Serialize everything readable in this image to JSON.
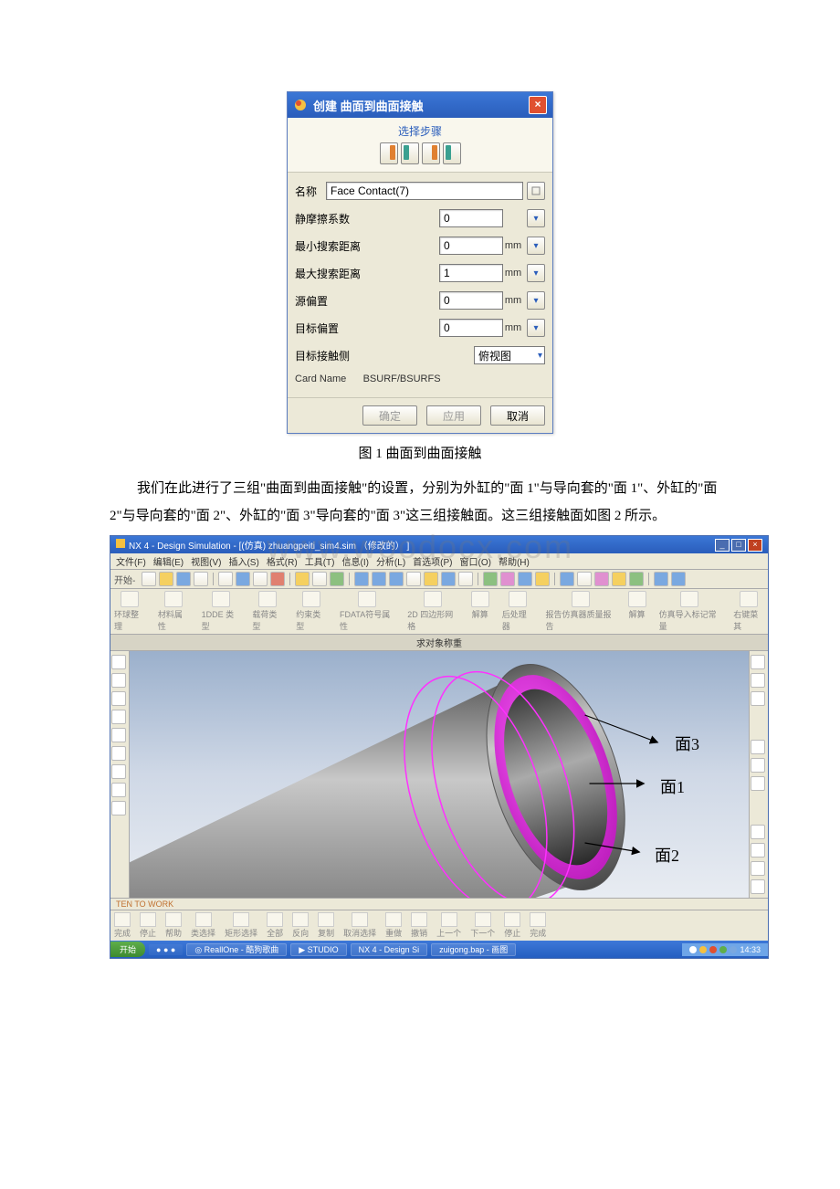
{
  "dialog": {
    "title": "创建  曲面到曲面接触",
    "steps_label": "选择步骤",
    "name_label": "名称",
    "name_value": "Face Contact(7)",
    "fields": [
      {
        "label": "静摩擦系数",
        "value": "0",
        "unit": ""
      },
      {
        "label": "最小搜索距离",
        "value": "0",
        "unit": "mm"
      },
      {
        "label": "最大搜索距离",
        "value": "1",
        "unit": "mm"
      },
      {
        "label": "源偏置",
        "value": "0",
        "unit": "mm"
      },
      {
        "label": "目标偏置",
        "value": "0",
        "unit": "mm"
      }
    ],
    "target_side_label": "目标接触侧",
    "target_side_value": "俯视图",
    "card_name_label": "Card Name",
    "card_name_value": "BSURF/BSURFS",
    "btn_ok": "确定",
    "btn_apply": "应用",
    "btn_cancel": "取消"
  },
  "caption1": "图 1 曲面到曲面接触",
  "paragraph": "我们在此进行了三组\"曲面到曲面接触\"的设置，分别为外缸的\"面 1\"与导向套的\"面 1\"、外缸的\"面 2\"与导向套的\"面 2\"、外缸的\"面 3\"导向套的\"面 3\"这三组接触面。这三组接触面如图 2 所示。",
  "watermark": "www.woodocx.com",
  "cad": {
    "title": "NX 4 - Design Simulation - [(仿真) zhuangpeiti_sim4.sim （修改的） ]",
    "menus": [
      "文件(F)",
      "编辑(E)",
      "视图(V)",
      "插入(S)",
      "格式(R)",
      "工具(T)",
      "信息(I)",
      "分析(L)",
      "首选项(P)",
      "窗口(O)",
      "帮助(H)"
    ],
    "toolbar_start": "开始-",
    "toolbar2": [
      "环球整理",
      "材料属性",
      "1DDE 类型",
      "载荷类型",
      "约束类型",
      "FDATA符号属性",
      "2D 四边形网格",
      "解算",
      "后处理器",
      "报告仿真器质量报告",
      "解算",
      "仿真导入标记常量",
      "右键菜其"
    ],
    "tab_label": "求对象称重",
    "status": "TEN TO WORK",
    "bottom_labels": [
      "完成",
      "停止",
      "帮助",
      "类选择",
      "矩形选择",
      "全部",
      "反向",
      "复制",
      "取消选择",
      "重做",
      "撤销",
      "上一个",
      "下一个",
      "停止",
      "完成"
    ],
    "taskbar": {
      "start": "开始",
      "items": [
        "◎ ReallOne - 酷狗歌曲",
        "▶ STUDIO",
        "NX 4 - Design Si",
        "zuigong.bap - 画图"
      ],
      "time": "14:33"
    },
    "annotations": {
      "face3": "面3",
      "face1": "面1",
      "face2": "面2"
    }
  }
}
